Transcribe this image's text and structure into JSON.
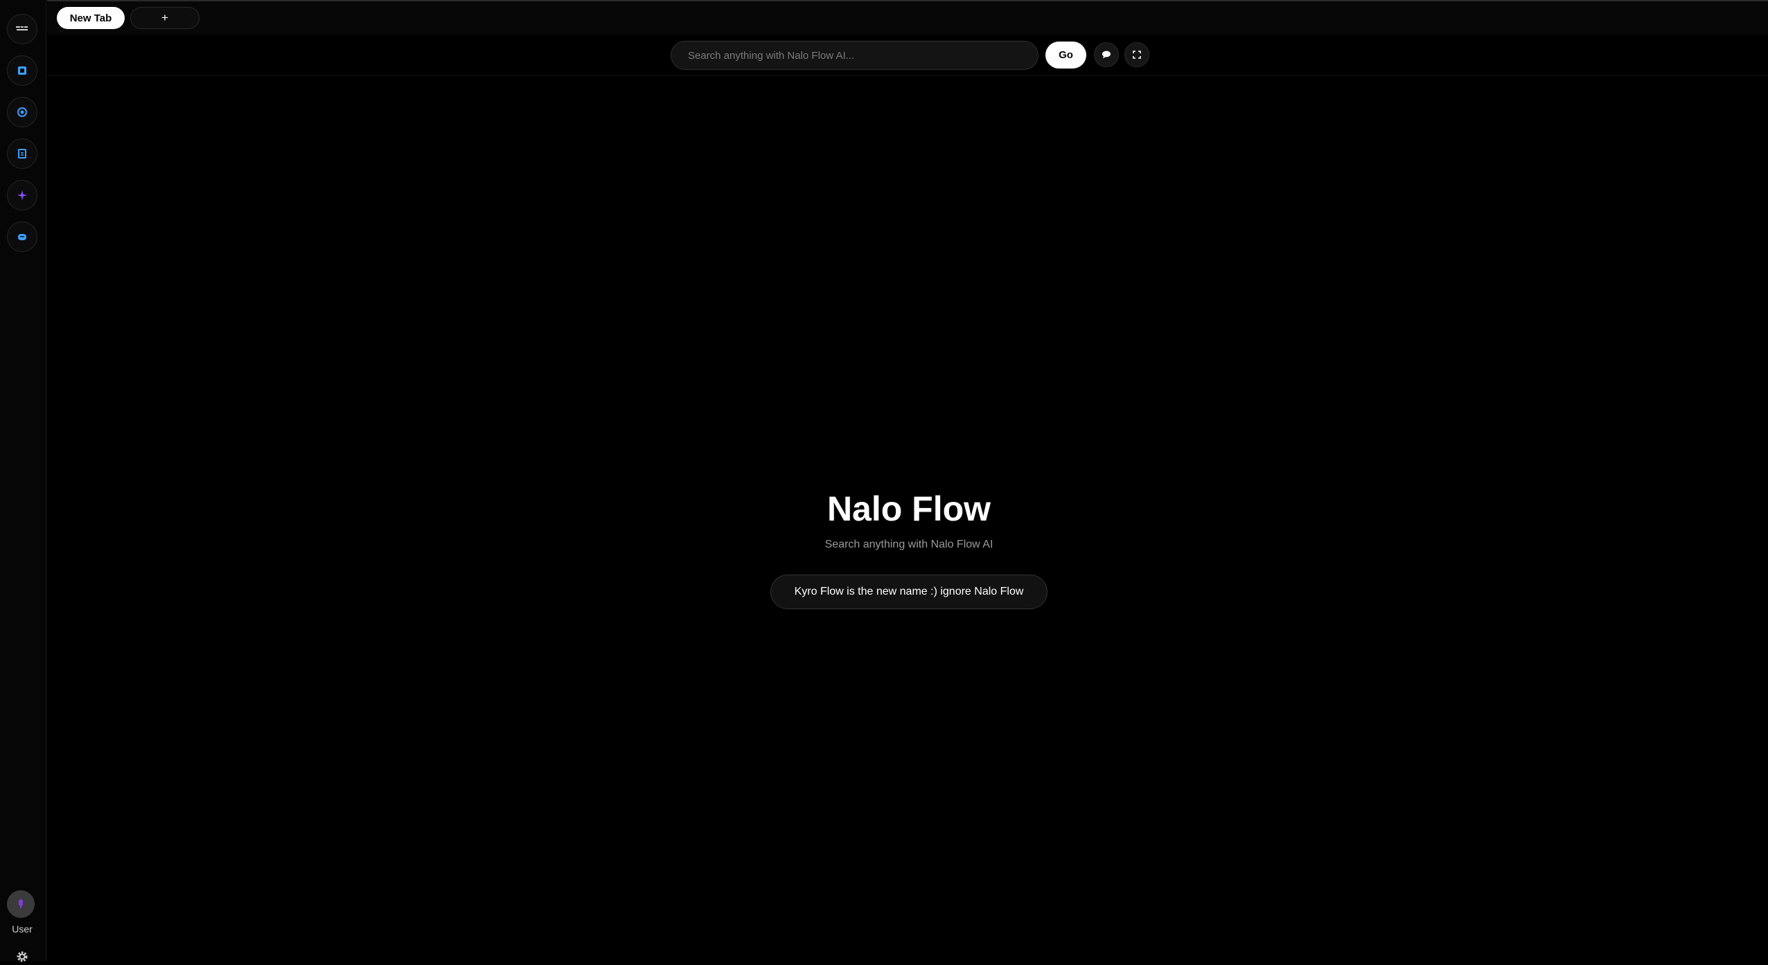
{
  "sidebar": {
    "items": [
      {
        "icon": "logo-icon",
        "color": "#cfcfcf"
      },
      {
        "icon": "square-icon",
        "color": "#3aa0ff"
      },
      {
        "icon": "target-icon",
        "color": "#3aa0ff"
      },
      {
        "icon": "document-icon",
        "color": "#3aa0ff"
      },
      {
        "icon": "sparkle-icon",
        "color": "#8a4dff"
      },
      {
        "icon": "gamepad-icon",
        "color": "#3aa0ff"
      }
    ],
    "user_label": "User",
    "avatar_icon": "mic-icon",
    "avatar_color": "#7e3fd6",
    "settings_icon": "gear-icon"
  },
  "tabs": {
    "active_label": "New Tab",
    "add_label": "+"
  },
  "toolbar": {
    "search_placeholder": "Search anything with Nalo Flow AI...",
    "go_label": "Go",
    "chat_icon": "chat-bubble-icon",
    "fullscreen_icon": "fullscreen-icon"
  },
  "hero": {
    "title": "Nalo Flow",
    "subtitle": "Search anything with Nalo Flow AI",
    "notice": "Kyro Flow is the new name :) ignore Nalo Flow"
  }
}
